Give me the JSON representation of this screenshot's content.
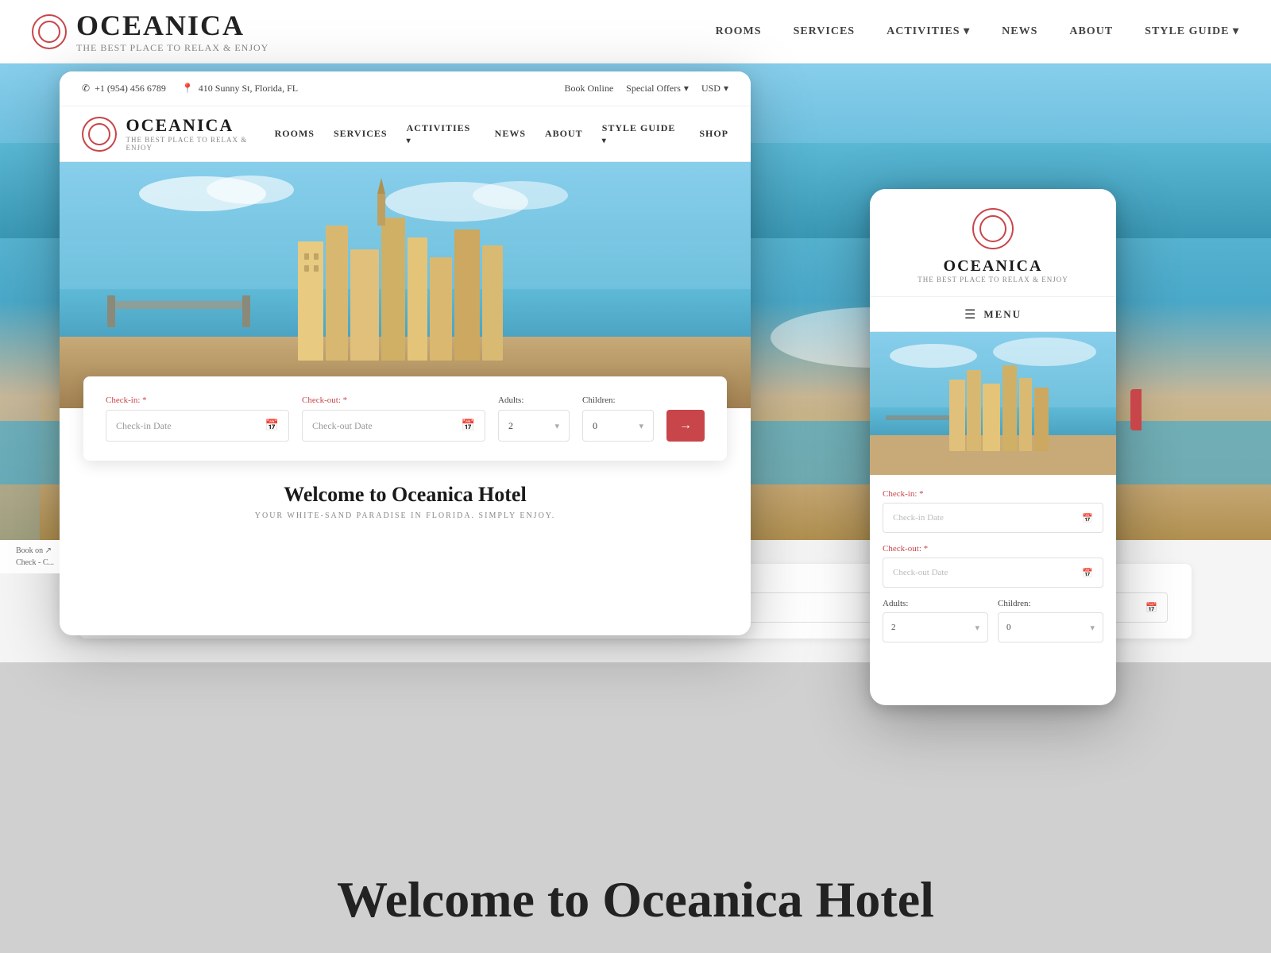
{
  "brand": {
    "name": "OCEANICA",
    "tagline": "THE BEST PLACE TO RELAX & ENJOY"
  },
  "topbar": {
    "phone": "+1 (954) 456 6789",
    "address": "410 Sunny St, Florida, FL",
    "book_online": "Book Online",
    "special_offers": "Special Offers",
    "currency": "USD"
  },
  "nav": {
    "links": [
      {
        "label": "ROOMS",
        "dropdown": false
      },
      {
        "label": "SERVICES",
        "dropdown": false
      },
      {
        "label": "ACTIVITIES",
        "dropdown": true
      },
      {
        "label": "NEWS",
        "dropdown": false
      },
      {
        "label": "ABOUT",
        "dropdown": false
      },
      {
        "label": "STYLE GUIDE",
        "dropdown": true
      },
      {
        "label": "SHOP",
        "dropdown": false
      }
    ]
  },
  "bg_nav": {
    "links": [
      "ROOMS",
      "SERVICES",
      "ACTIVITIES",
      "NEWS",
      "ABOUT",
      "STYLE GUIDE"
    ]
  },
  "booking_form": {
    "checkin_label": "Check-in:",
    "checkin_placeholder": "Check-in Date",
    "checkout_label": "Check-out:",
    "checkout_placeholder": "Check-out Date",
    "adults_label": "Adults:",
    "adults_value": "2",
    "children_label": "Children:",
    "children_value": "0",
    "required_mark": "*"
  },
  "welcome": {
    "title": "Welcome to Oceanica Hotel",
    "subtitle": "YOUR WHITE-SAND PARADISE IN FLORIDA. SIMPLY ENJOY."
  },
  "page_bottom": {
    "title": "Welcome to Oceanica Hotel"
  },
  "mobile": {
    "menu_label": "MENU",
    "checkin_label": "Check-in:",
    "checkin_placeholder": "Check-in Date",
    "checkout_label": "Check-out:",
    "checkout_placeholder": "Check-out Date",
    "adults_label": "Adults:",
    "adults_value": "2",
    "children_label": "Children:",
    "children_value": "0"
  },
  "icons": {
    "phone": "✆",
    "location": "📍",
    "calendar": "📅",
    "chevron_down": "▾",
    "hamburger": "☰",
    "arrow_right": "→"
  },
  "colors": {
    "accent": "#c8454a",
    "text_dark": "#1a1a1a",
    "text_muted": "#888888",
    "border": "#e0e0e0"
  }
}
